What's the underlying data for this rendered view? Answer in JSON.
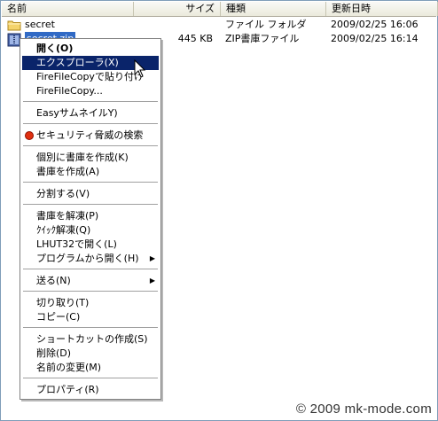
{
  "columns": {
    "name": "名前",
    "size": "サイズ",
    "type": "種類",
    "modified": "更新日時"
  },
  "files": [
    {
      "name": "secret",
      "size": "",
      "type": "ファイル フォルダ",
      "modified": "2009/02/25 16:06",
      "icon": "folder-icon"
    },
    {
      "name": "secret.zip",
      "size": "445 KB",
      "type": "ZIP書庫ファイル",
      "modified": "2009/02/25 16:14",
      "icon": "zip-file-icon"
    }
  ],
  "context_menu": {
    "items": [
      {
        "label": "開く(O)",
        "bold": true
      },
      {
        "label": "エクスプローラ(X)",
        "highlighted": true
      },
      {
        "label": "FireFileCopyで貼り付け"
      },
      {
        "label": "FireFileCopy..."
      },
      {
        "label": "EasyサムネイルY)"
      },
      {
        "label": "セキュリティ脅威の検索",
        "icon": "security-scan-icon"
      },
      {
        "label": "個別に書庫を作成(K)"
      },
      {
        "label": "書庫を作成(A)"
      },
      {
        "label": "分割する(V)"
      },
      {
        "label": "書庫を解凍(P)"
      },
      {
        "label": "ｸｲｯｸ解凍(Q)"
      },
      {
        "label": "LHUT32で開く(L)"
      },
      {
        "label": "プログラムから開く(H)",
        "submenu": true
      },
      {
        "label": "送る(N)",
        "submenu": true
      },
      {
        "label": "切り取り(T)"
      },
      {
        "label": "コピー(C)"
      },
      {
        "label": "ショートカットの作成(S)"
      },
      {
        "label": "削除(D)"
      },
      {
        "label": "名前の変更(M)"
      },
      {
        "label": "プロパティ(R)"
      }
    ],
    "submenu_arrow": "▶"
  },
  "watermark": "© 2009 mk-mode.com"
}
